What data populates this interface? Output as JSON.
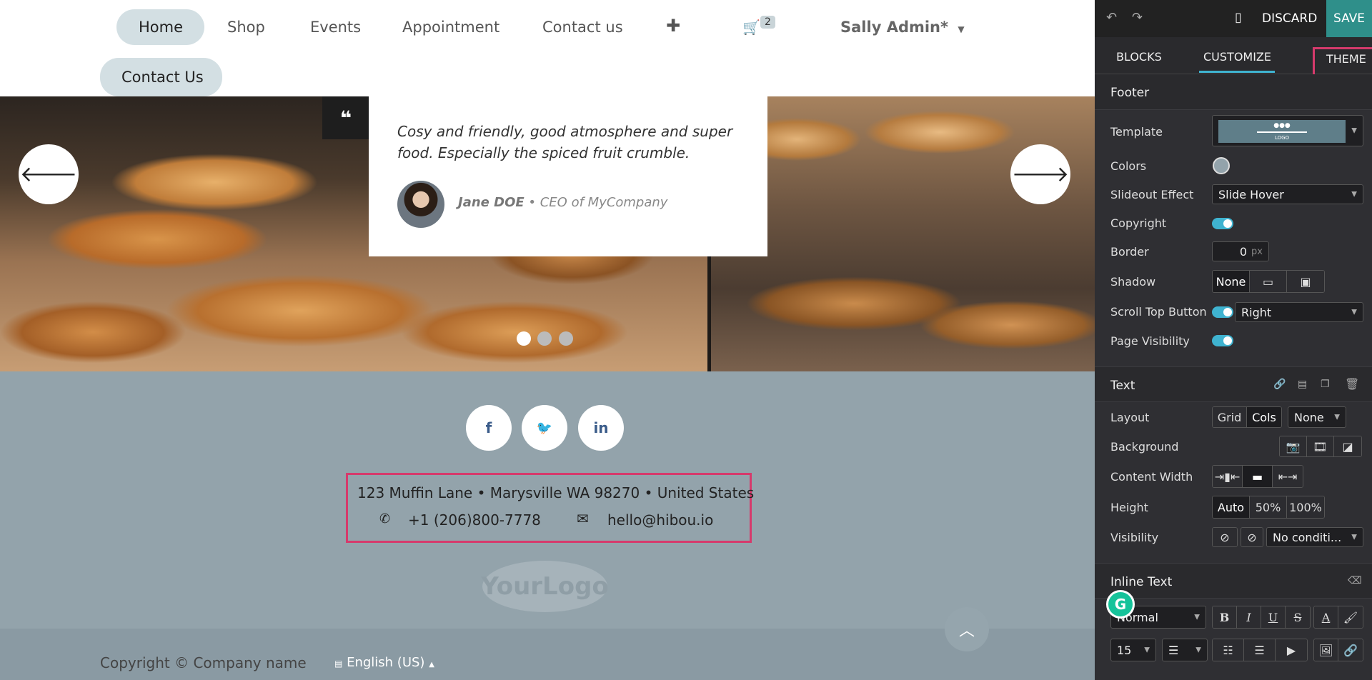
{
  "nav": {
    "items": [
      "Home",
      "Shop",
      "Events",
      "Appointment",
      "Contact us"
    ],
    "add_icon": "plus-icon",
    "cart_count": "2",
    "user": "Sally Admin*",
    "contact_button": "Contact Us"
  },
  "hero": {
    "quote": "Cosy and friendly, good atmosphere and super food. Especially the spiced fruit crumble.",
    "author_name": "Jane DOE",
    "author_role": " • CEO of MyCompany",
    "quote_mark": "❝",
    "slide_count": 3,
    "active_slide": 1
  },
  "footer": {
    "social": [
      "f",
      "🐦",
      "in"
    ],
    "address": "123 Muffin Lane • Marysville WA 98270 • United States",
    "phone": "+1 (206)800-7778",
    "email": "hello@hibou.io",
    "logo_text": "YourLogo",
    "copyright": "Copyright © Company name",
    "language": "English (US)"
  },
  "panel": {
    "discard": "DISCARD",
    "save": "SAVE",
    "tabs": [
      "BLOCKS",
      "CUSTOMIZE",
      "THEME"
    ],
    "footer_section": "Footer",
    "template_logo": "LOGO",
    "labels": {
      "template": "Template",
      "colors": "Colors",
      "slideout": "Slideout Effect",
      "copyright": "Copyright",
      "border": "Border",
      "shadow": "Shadow",
      "scroll_top": "Scroll Top Button",
      "page_visibility": "Page Visibility"
    },
    "slideout_value": "Slide Hover",
    "border_value": "0",
    "border_unit": "px",
    "shadow_none": "None",
    "scroll_top_value": "Right",
    "text_section": "Text",
    "text_labels": {
      "layout": "Layout",
      "background": "Background",
      "content_width": "Content Width",
      "height": "Height",
      "visibility": "Visibility"
    },
    "layout_options": [
      "Grid",
      "Cols"
    ],
    "layout_none": "None",
    "height_options": [
      "Auto",
      "50%",
      "100%"
    ],
    "visibility_value": "No conditi...",
    "inline_section": "Inline Text",
    "format_value": "Normal",
    "font_size": "15",
    "grammarly": "G"
  },
  "colors": {
    "accent": "#3fb3d0",
    "save_bg": "#2f8f8a",
    "highlight": "#d63a6c",
    "footer_bg": "#93a3ab"
  }
}
